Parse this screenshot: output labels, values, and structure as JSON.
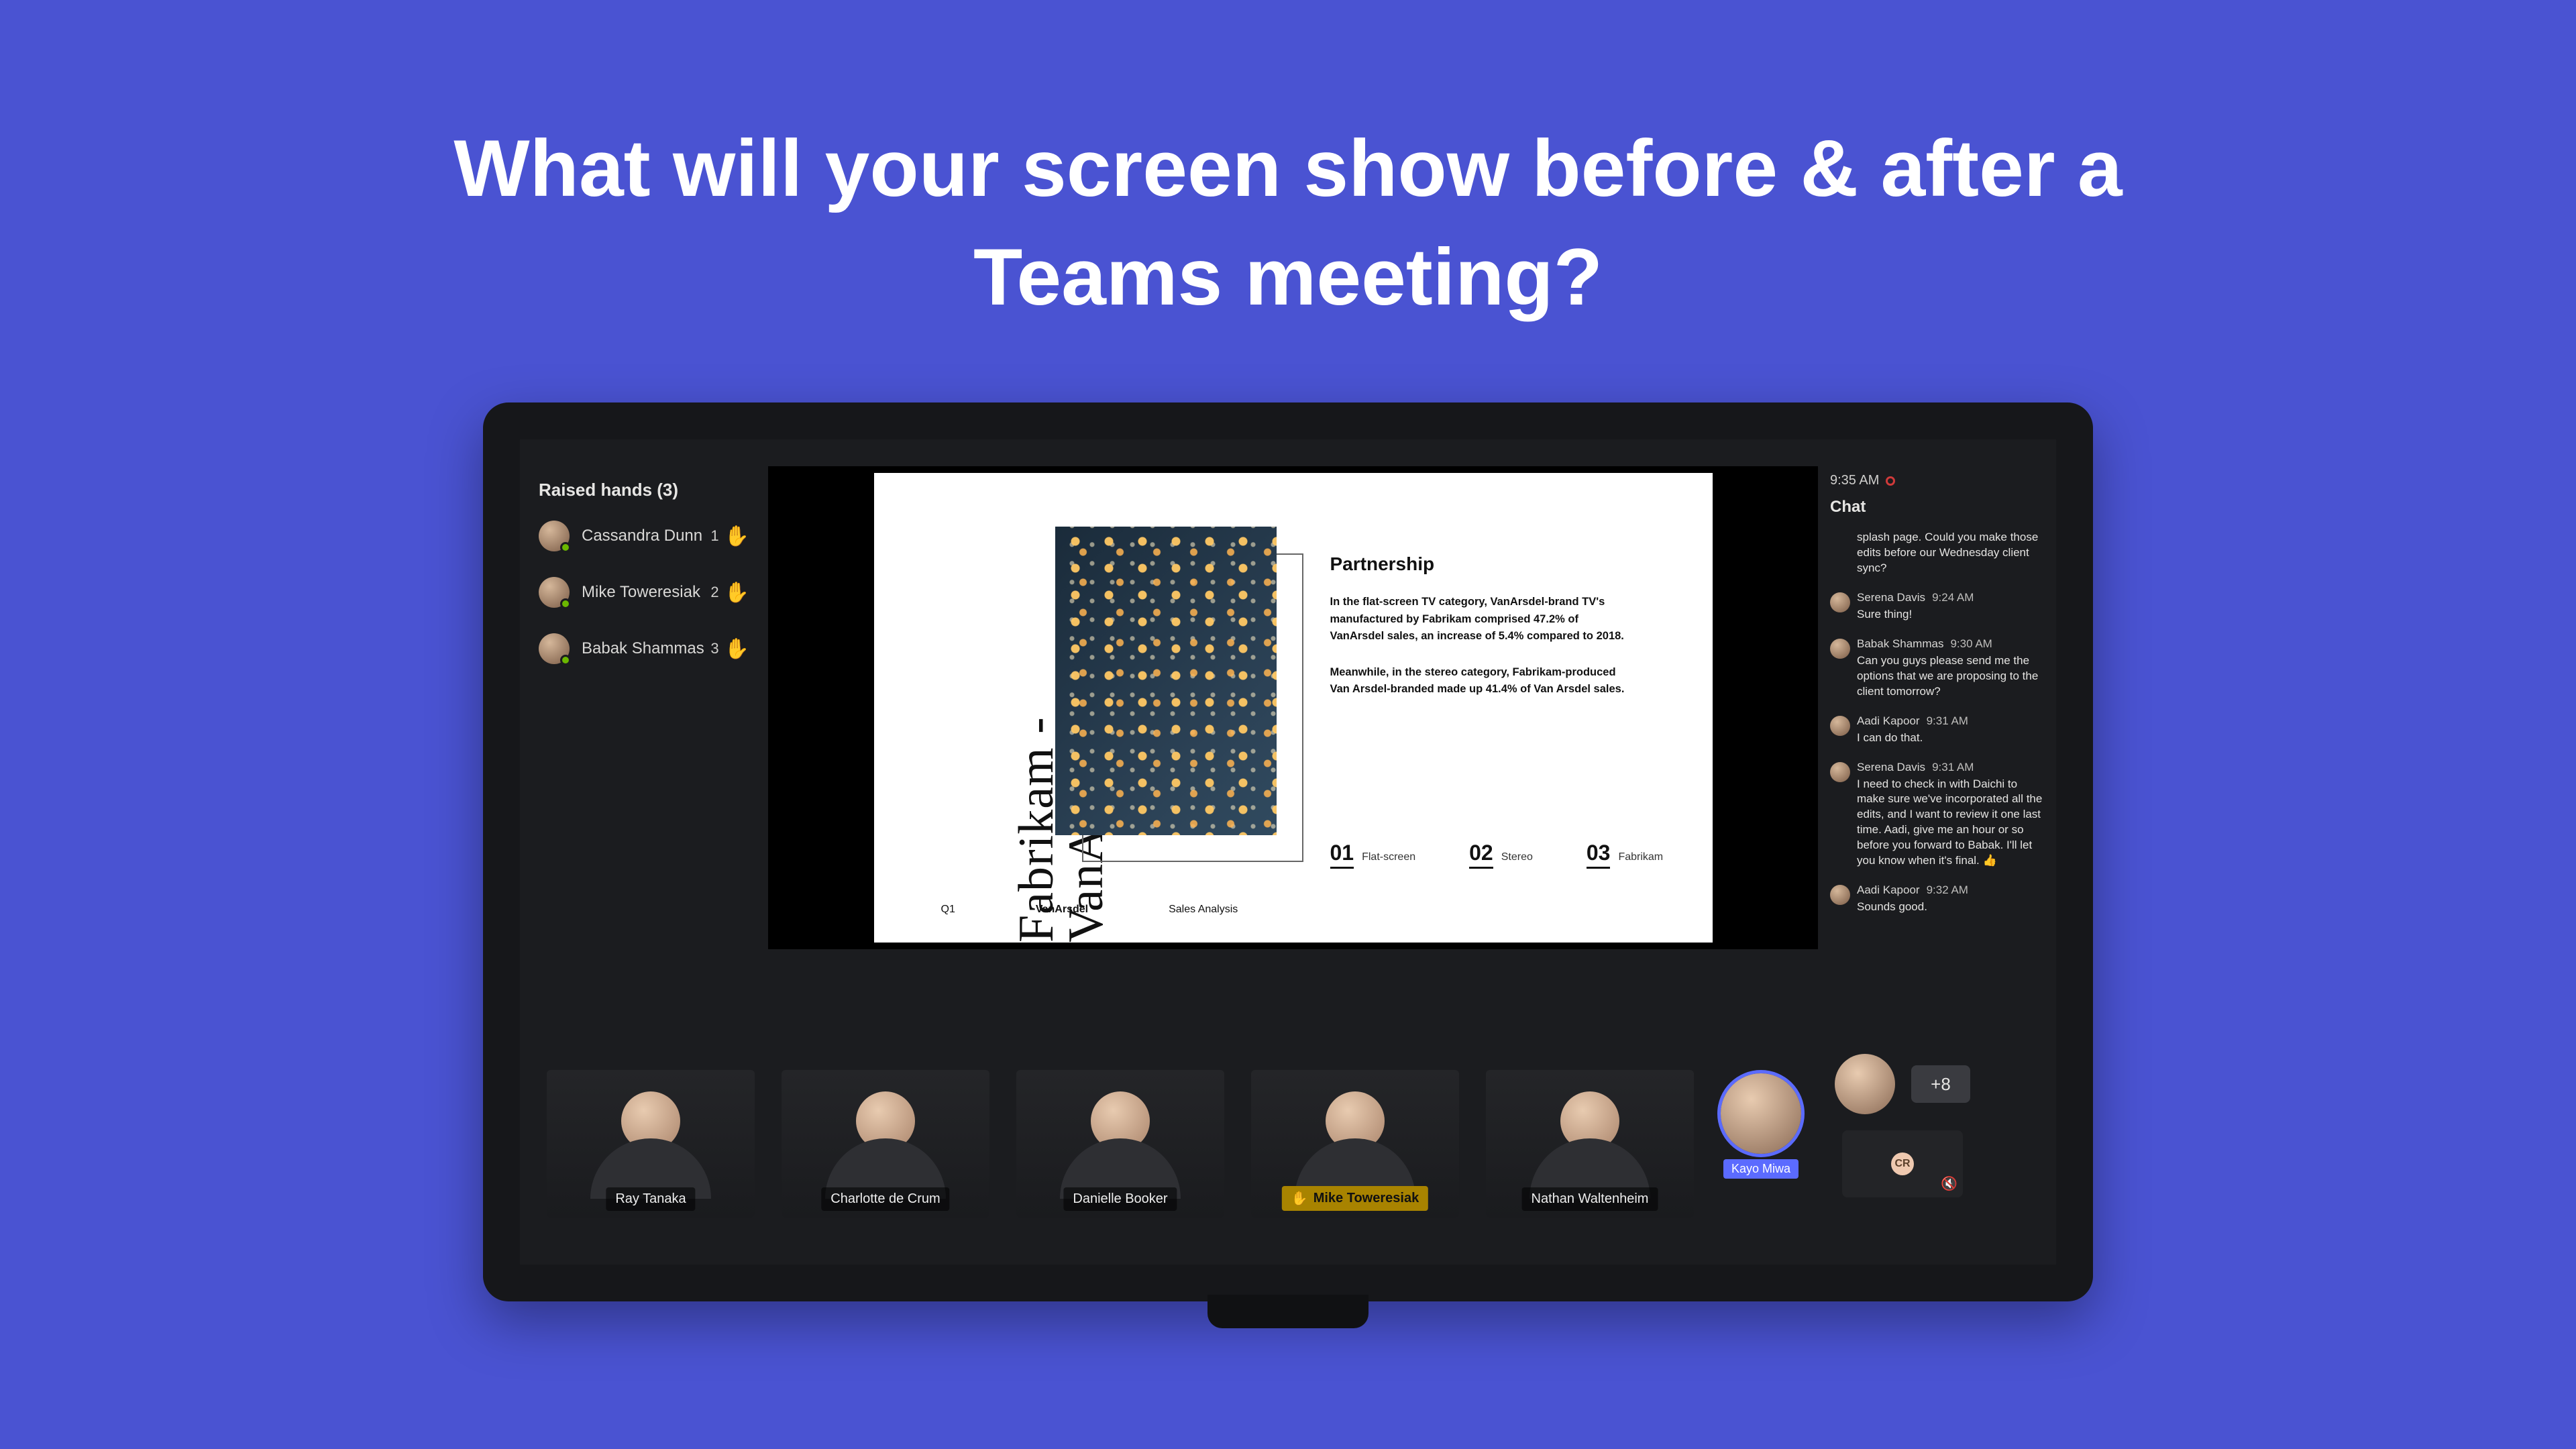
{
  "headline": "What will your screen show before & after a Teams meeting?",
  "hands": {
    "title": "Raised hands (3)",
    "items": [
      {
        "name": "Cassandra Dunn",
        "order": "1"
      },
      {
        "name": "Mike Toweresiak",
        "order": "2"
      },
      {
        "name": "Babak Shammas",
        "order": "3"
      }
    ]
  },
  "slide": {
    "vertical_title": "Fabrikam - VanArsdel",
    "heading": "Partnership",
    "para1": "In the flat-screen TV category, VanArsdel-brand TV's manufactured by Fabrikam comprised 47.2% of VanArsdel sales, an increase of 5.4% compared to 2018.",
    "para2": "Meanwhile, in the stereo category, Fabrikam-produced Van Arsdel-branded made up 41.4% of Van Arsdel sales.",
    "nums": [
      {
        "n": "01",
        "label": "Flat-screen"
      },
      {
        "n": "02",
        "label": "Stereo"
      },
      {
        "n": "03",
        "label": "Fabrikam"
      }
    ],
    "footer_q": "Q1",
    "footer_brand": "VanArsdel",
    "footer_sub": "Sales Analysis"
  },
  "chat": {
    "time": "9:35 AM",
    "header": "Chat",
    "messages": [
      {
        "name": "",
        "time": "",
        "text": "splash page. Could you make those edits before our Wednesday client sync?"
      },
      {
        "name": "Serena Davis",
        "time": "9:24 AM",
        "text": "Sure thing!"
      },
      {
        "name": "Babak Shammas",
        "time": "9:30 AM",
        "text": "Can you guys please send me the options that we are proposing to the client tomorrow?"
      },
      {
        "name": "Aadi Kapoor",
        "time": "9:31 AM",
        "text": "I can do that."
      },
      {
        "name": "Serena Davis",
        "time": "9:31 AM",
        "text": "I need to check in with Daichi to make sure we've incorporated all the edits, and I want to review it one last time. Aadi, give me an hour or so before you forward to Babak. I'll let you know when it's final. 👍"
      },
      {
        "name": "Aadi Kapoor",
        "time": "9:32 AM",
        "text": "Sounds good."
      }
    ]
  },
  "participants": {
    "tiles": [
      {
        "name": "Ray Tanaka",
        "raised": false
      },
      {
        "name": "Charlotte de Crum",
        "raised": false
      },
      {
        "name": "Danielle Booker",
        "raised": false
      },
      {
        "name": "Mike Toweresiak",
        "raised": true
      },
      {
        "name": "Nathan Waltenheim",
        "raised": false
      }
    ],
    "speaker_circle": "Kayo Miwa",
    "overflow": "+8",
    "self_initials": "CR"
  }
}
